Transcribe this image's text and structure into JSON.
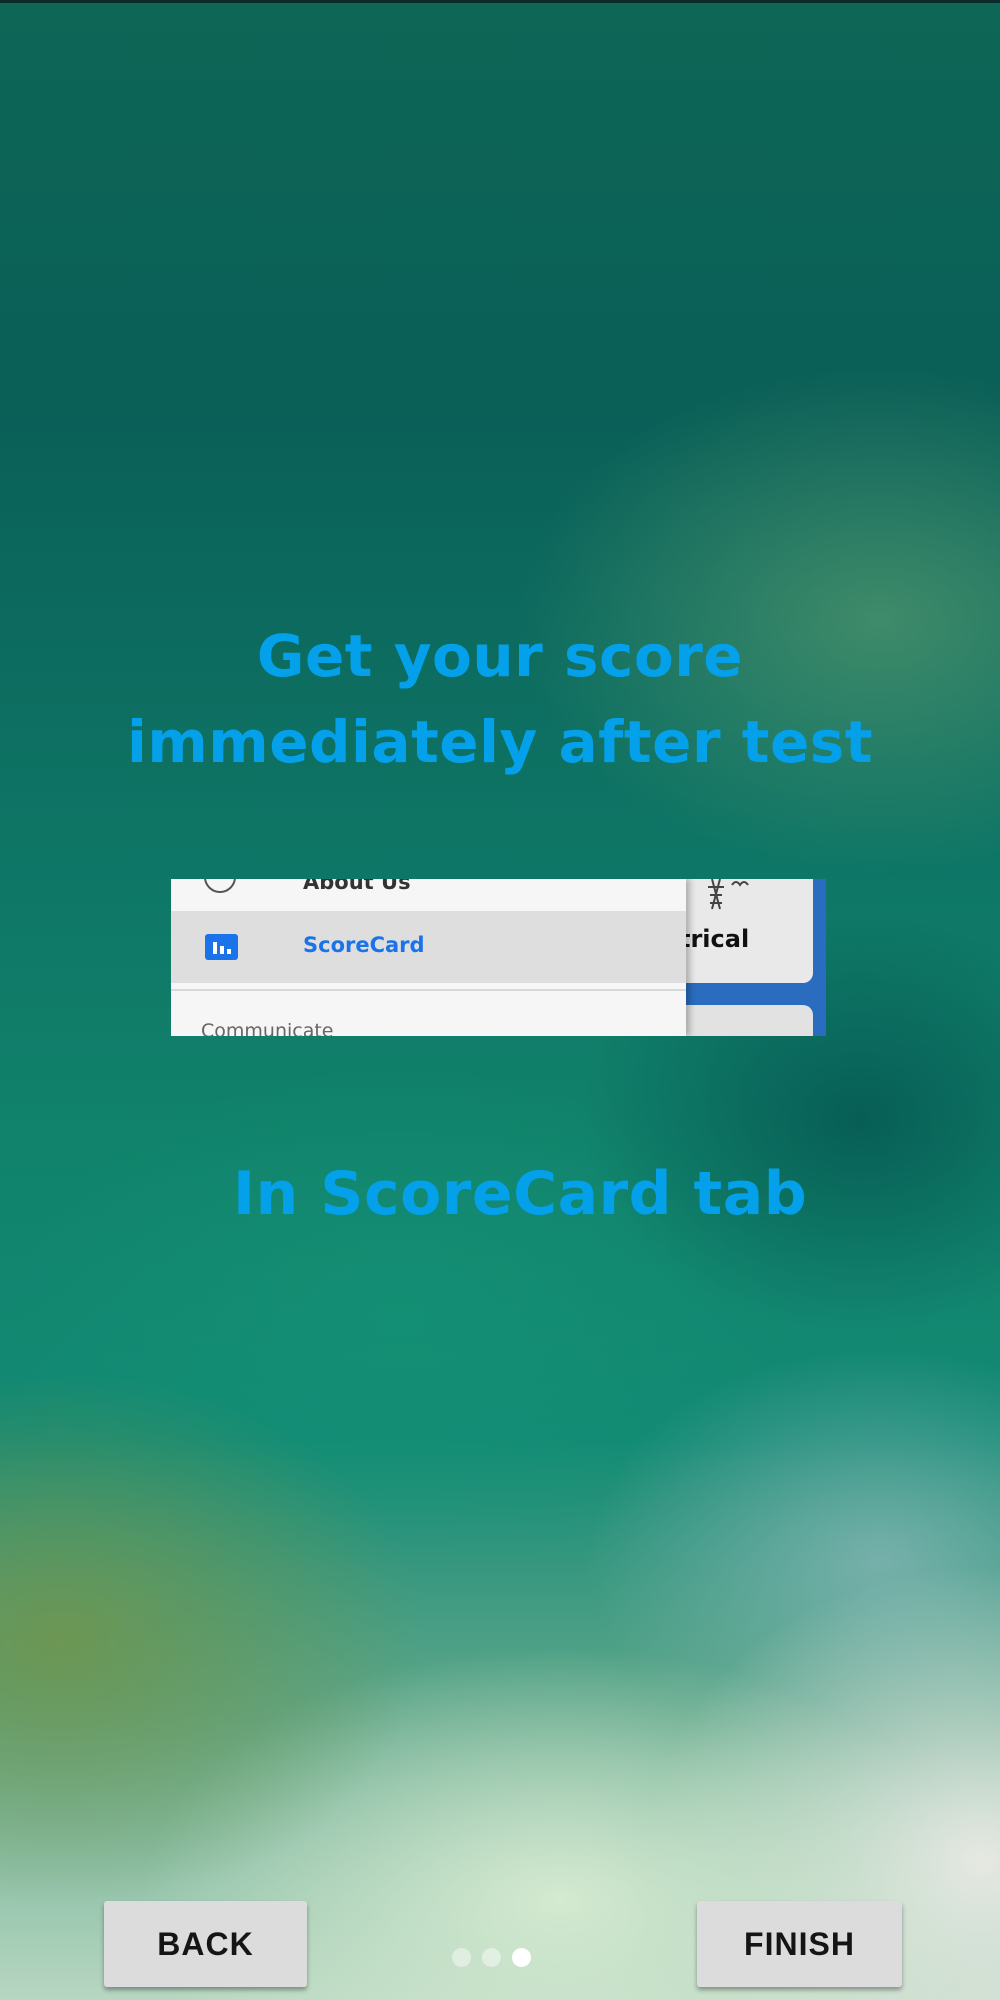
{
  "onboarding": {
    "title_line_1": "Get your score",
    "title_line_2": "immediately after test",
    "subtitle": "In ScoreCard tab",
    "page_count": 3,
    "current_page": 3
  },
  "preview": {
    "about_label": "About Us",
    "scorecard_label": "ScoreCard",
    "communicate_label": "Communicate",
    "card_text": "trical"
  },
  "navigation": {
    "back_label": "BACK",
    "finish_label": "FINISH"
  },
  "colors": {
    "headline": "#04a0ea",
    "scorecard_accent": "#1a73e8",
    "button_bg": "#dcdcdc"
  }
}
